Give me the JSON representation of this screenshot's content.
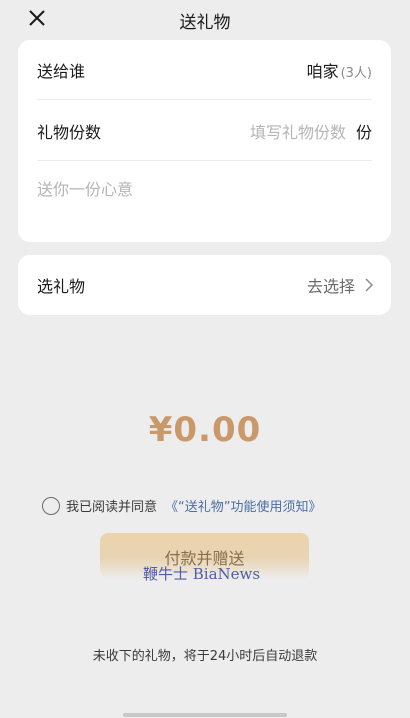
{
  "nav": {
    "title": "送礼物"
  },
  "form": {
    "recipient_label": "送给谁",
    "recipient_name": "咱家",
    "recipient_count": "(3人)",
    "quantity_label": "礼物份数",
    "quantity_placeholder": "填写礼物份数",
    "quantity_unit": "份",
    "message_placeholder": "送你一份心意"
  },
  "gift": {
    "label": "选礼物",
    "action": "去选择"
  },
  "amount": "¥0.00",
  "agreement": {
    "text": "我已阅读并同意",
    "link": "《“送礼物”功能使用须知》"
  },
  "pay_button": "付款并赠送",
  "watermark": "鞭牛士 BiaNews",
  "notice": "未收下的礼物，将于24小时后自动退款",
  "colors": {
    "amount": "#c9996a",
    "link": "#4a6ea6",
    "pay_button": "#ebd3ad",
    "background": "#ededed"
  }
}
